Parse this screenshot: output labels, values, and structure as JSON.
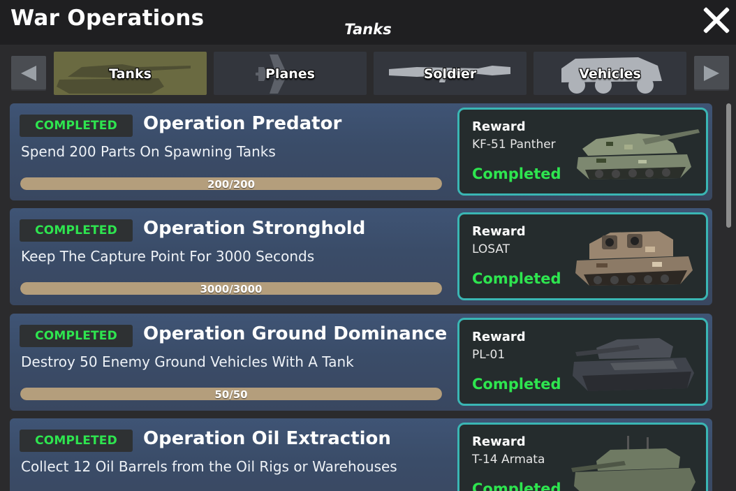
{
  "header": {
    "title": "War Operations",
    "subtitle": "Tanks"
  },
  "tabs": [
    {
      "label": "Tanks",
      "icon": "tank-icon",
      "active": true
    },
    {
      "label": "Planes",
      "icon": "plane-icon",
      "active": false
    },
    {
      "label": "Soldier",
      "icon": "rifle-icon",
      "active": false
    },
    {
      "label": "Vehicles",
      "icon": "vehicle-icon",
      "active": false
    }
  ],
  "operations": [
    {
      "status": "COMPLETED",
      "title": "Operation Predator",
      "description": "Spend 200 Parts On Spawning Tanks",
      "progress_text": "200/200",
      "progress": 1.0,
      "reward_label": "Reward",
      "reward_item": "KF-51 Panther",
      "reward_status": "Completed",
      "camo": "woodland"
    },
    {
      "status": "COMPLETED",
      "title": "Operation Stronghold",
      "description": "Keep The Capture Point For 3000 Seconds",
      "progress_text": "3000/3000",
      "progress": 1.0,
      "reward_label": "Reward",
      "reward_item": "LOSAT",
      "reward_status": "Completed",
      "camo": "desert"
    },
    {
      "status": "COMPLETED",
      "title": "Operation Ground Dominance",
      "description": "Destroy 50 Enemy Ground Vehicles With A Tank",
      "progress_text": "50/50",
      "progress": 1.0,
      "reward_label": "Reward",
      "reward_item": "PL-01",
      "reward_status": "Completed",
      "camo": "dark"
    },
    {
      "status": "COMPLETED",
      "title": "Operation Oil Extraction",
      "description": "Collect 12 Oil Barrels from the Oil Rigs or Warehouses",
      "progress_text": "",
      "progress": 1.0,
      "reward_label": "Reward",
      "reward_item": "T-14 Armata",
      "reward_status": "Completed",
      "camo": "green"
    }
  ],
  "colors": {
    "completed": "#2ee54f",
    "reward_border": "#3ab6b4",
    "progress_fill": "#b49e7c",
    "active_tab": "#6a6a41"
  }
}
